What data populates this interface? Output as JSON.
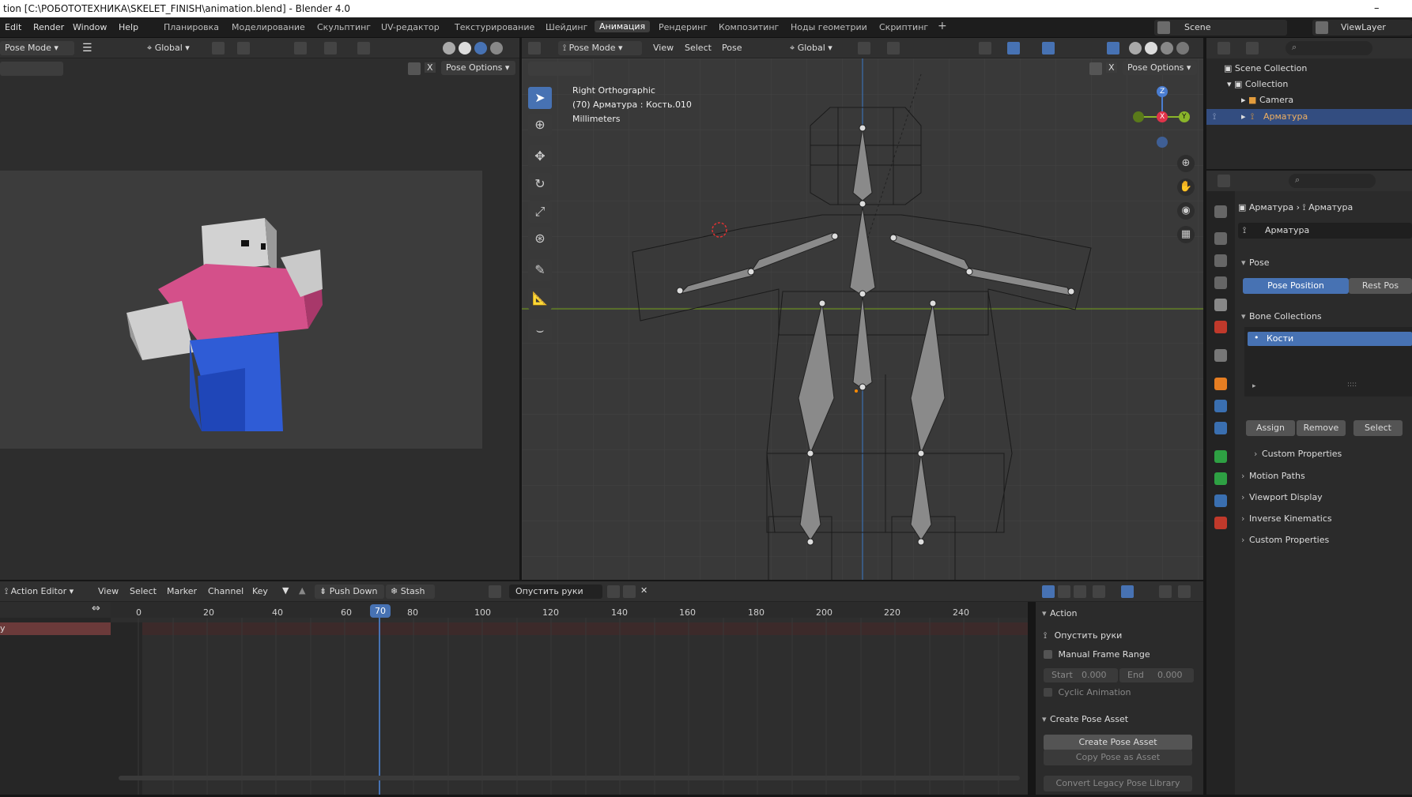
{
  "window": {
    "title": "tion [C:\\РОБОТОТЕХНИКА\\SKELET_FINISH\\animation.blend] - Blender 4.0",
    "minimize": "–"
  },
  "menu": {
    "edit": "Edit",
    "render": "Render",
    "window": "Window",
    "help": "Help"
  },
  "workspaces": [
    "Планировка",
    "Моделирование",
    "Скульптинг",
    "UV-редактор",
    "Текстурирование",
    "Шейдинг",
    "Анимация",
    "Рендеринг",
    "Композитинг",
    "Ноды геометрии",
    "Скриптинг"
  ],
  "active_workspace": "Анимация",
  "add_workspace": "+",
  "scene": {
    "label": "Scene",
    "view_layer": "ViewLayer"
  },
  "left_viewport": {
    "mode": "Pose Mode",
    "orientation": "Global",
    "pose_options": "Pose Options",
    "close": "X"
  },
  "main_viewport": {
    "mode": "Pose Mode",
    "menus": [
      "View",
      "Select",
      "Pose"
    ],
    "orientation": "Global",
    "pose_options": "Pose Options",
    "close": "X",
    "overlay_title": "Right Orthographic",
    "overlay_object": "(70) Арматура : Кость.010",
    "overlay_units": "Millimeters",
    "gizmo": {
      "z": "Z",
      "x": "X",
      "y": "Y"
    }
  },
  "outliner": {
    "scene_collection": "Scene Collection",
    "collection": "Collection",
    "camera": "Camera",
    "armature": "Арматура"
  },
  "properties": {
    "breadcrumb_a": "Арматура",
    "breadcrumb_b": "Арматура",
    "data_name": "Арматура",
    "pose": "Pose",
    "pose_position": "Pose Position",
    "rest_position": "Rest Pos",
    "bone_collections": "Bone Collections",
    "bone_collection_item": "Кости",
    "assign": "Assign",
    "remove": "Remove",
    "select": "Select",
    "custom_props_inner": "Custom Properties",
    "motion_paths": "Motion Paths",
    "viewport_display": "Viewport Display",
    "inverse_kinematics": "Inverse Kinematics",
    "custom_props": "Custom Properties"
  },
  "action_editor": {
    "mode": "Action Editor",
    "menus": [
      "View",
      "Select",
      "Marker",
      "Channel",
      "Key"
    ],
    "push_down": "Push Down",
    "stash": "Stash",
    "action_name": "Опустить руки",
    "current_frame": "70",
    "ticks": [
      "0",
      "20",
      "40",
      "60",
      "80",
      "100",
      "120",
      "140",
      "160",
      "180",
      "200",
      "220",
      "240"
    ],
    "channel_stub": "y"
  },
  "action_panel": {
    "title": "Action",
    "action_name": "Опустить руки",
    "manual_range": "Manual Frame Range",
    "start_label": "Start",
    "start_value": "0.000",
    "end_label": "End",
    "end_value": "0.000",
    "cyclic": "Cyclic Animation",
    "pose_asset_title": "Create Pose Asset",
    "create_pose_asset": "Create Pose Asset",
    "copy_pose_asset": "Copy Pose as Asset",
    "convert_legacy": "Convert Legacy Pose Library"
  },
  "colors": {
    "accent": "#4772b3",
    "header": "#303030",
    "viewport": "#393939",
    "selected_row": "#334d80"
  }
}
